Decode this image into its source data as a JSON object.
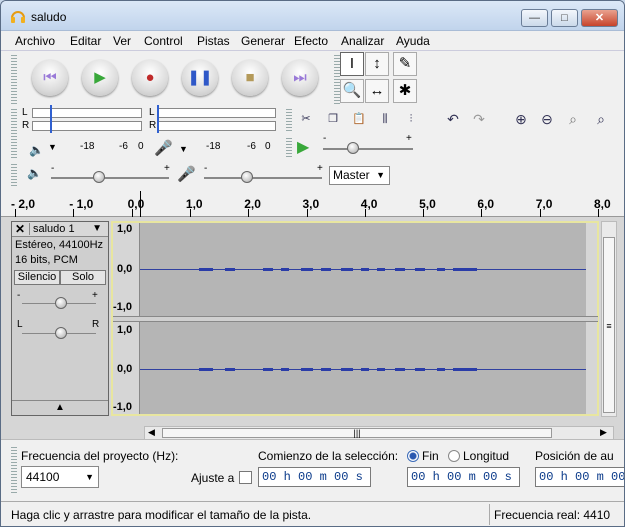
{
  "window": {
    "title": "saludo",
    "minimize": "—",
    "maximize": "□",
    "close": "✕"
  },
  "menu": [
    "Archivo",
    "Editar",
    "Ver",
    "Control",
    "Pistas",
    "Generar",
    "Efecto",
    "Analizar",
    "Ayuda"
  ],
  "transport": [
    {
      "name": "skip-start",
      "glyph": "⏮",
      "color": "#9a7ad8"
    },
    {
      "name": "play",
      "glyph": "▶",
      "color": "#39a83a"
    },
    {
      "name": "record",
      "glyph": "●",
      "color": "#c02b2b"
    },
    {
      "name": "pause",
      "glyph": "❚❚",
      "color": "#2f58c8"
    },
    {
      "name": "stop",
      "glyph": "■",
      "color": "#b49a5a"
    },
    {
      "name": "skip-end",
      "glyph": "⏭",
      "color": "#9a7ad8"
    }
  ],
  "tools": [
    "I",
    "↕",
    "✎",
    "🔍",
    "↔",
    "✱"
  ],
  "meters": {
    "L": "L",
    "R": "R",
    "play_scale": [
      "-18",
      "-6",
      "0"
    ],
    "rec_scale": [
      "-18",
      "-6",
      "0"
    ]
  },
  "mixer": {
    "minus": "-",
    "plus": "+",
    "source": "Master"
  },
  "ruler": [
    "- 2,0",
    "- 1,0",
    "0,0",
    "1,0",
    "2,0",
    "3,0",
    "4,0",
    "5,0",
    "6,0",
    "7,0",
    "8,0"
  ],
  "track": {
    "name": "saludo 1",
    "info1": "Estéreo, 44100Hz",
    "info2": "16 bits, PCM",
    "mute": "Silencio",
    "solo": "Solo",
    "gain_minus": "-",
    "gain_plus": "+",
    "pan_l": "L",
    "pan_r": "R"
  },
  "scale": [
    "1,0",
    "0,0",
    "-1,0",
    "1,0",
    "0,0",
    "-1,0"
  ],
  "selection": {
    "rate_label": "Frecuencia del proyecto (Hz):",
    "rate_value": "44100",
    "start_label": "Comienzo de la selección:",
    "end_option": "Fin",
    "length_option": "Longitud",
    "snap_label": "Ajuste a",
    "pos_label": "Posición de au",
    "time1": "00 h 00 m 00 s",
    "time2": "00 h 00 m 00 s",
    "time3": "00 h 00 m 00"
  },
  "status": {
    "left": "Haga clic y arrastre para modificar el tamaño de la pista.",
    "right": "Frecuencia real: 4410"
  }
}
